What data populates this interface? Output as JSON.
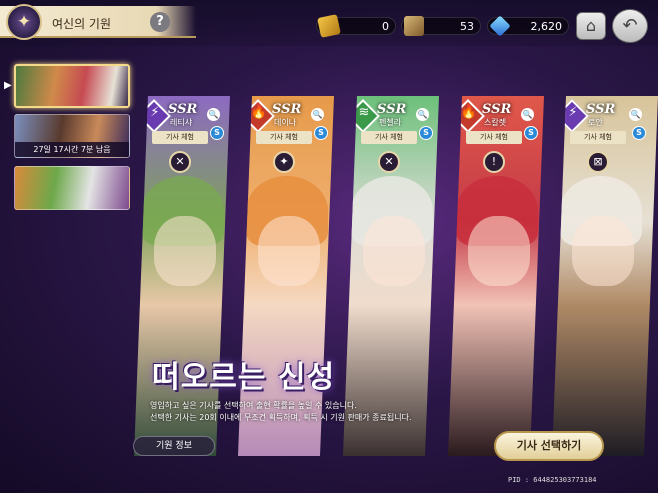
{
  "header": {
    "title": "여신의 기원",
    "help_icon": "question-icon",
    "emblem_icon": "compass-emblem-icon"
  },
  "resources": [
    {
      "icon": "summon-ticket-icon",
      "value": "0"
    },
    {
      "icon": "knight-book-icon",
      "value": "53"
    },
    {
      "icon": "diamond-gem-icon",
      "value": "2,620"
    }
  ],
  "nav": {
    "home_icon": "home-icon",
    "back_icon": "back-arrow-icon"
  },
  "banners": [
    {
      "name": "rising-star-banner",
      "selected": true,
      "timer": ""
    },
    {
      "name": "limited-banner",
      "selected": false,
      "timer": "27일 17시간 7분 남음"
    },
    {
      "name": "group-banner",
      "selected": false,
      "timer": ""
    }
  ],
  "cards": [
    {
      "rank": "SSR",
      "name": "레티샤",
      "element": "dark",
      "trial": "기사 체험"
    },
    {
      "rank": "SSR",
      "name": "데이나",
      "element": "fire",
      "trial": "기사 체험"
    },
    {
      "rank": "SSR",
      "name": "펜첼라",
      "element": "wind",
      "trial": "기사 체험"
    },
    {
      "rank": "SSR",
      "name": "스칼렛",
      "element": "fire",
      "trial": "기사 체험"
    },
    {
      "rank": "SSR",
      "name": "로안",
      "element": "dark",
      "trial": "기사 체험"
    }
  ],
  "event": {
    "title": "떠오르는 신성",
    "desc_line1": "영입하고 싶은 기사를 선택하여 출현 확률을 높일 수 있습니다.",
    "desc_line2": "선택한 기사는 20회 이내에 무조건 획득하며, 획득 시 기원 판매가 종료됩니다."
  },
  "buttons": {
    "info": "기원 정보",
    "select": "기사 선택하기"
  },
  "footer": {
    "pid": "PID : 644825303773184"
  },
  "colors": {
    "accent_gold": "#e2cf98",
    "bg_purple": "#2b1748"
  }
}
